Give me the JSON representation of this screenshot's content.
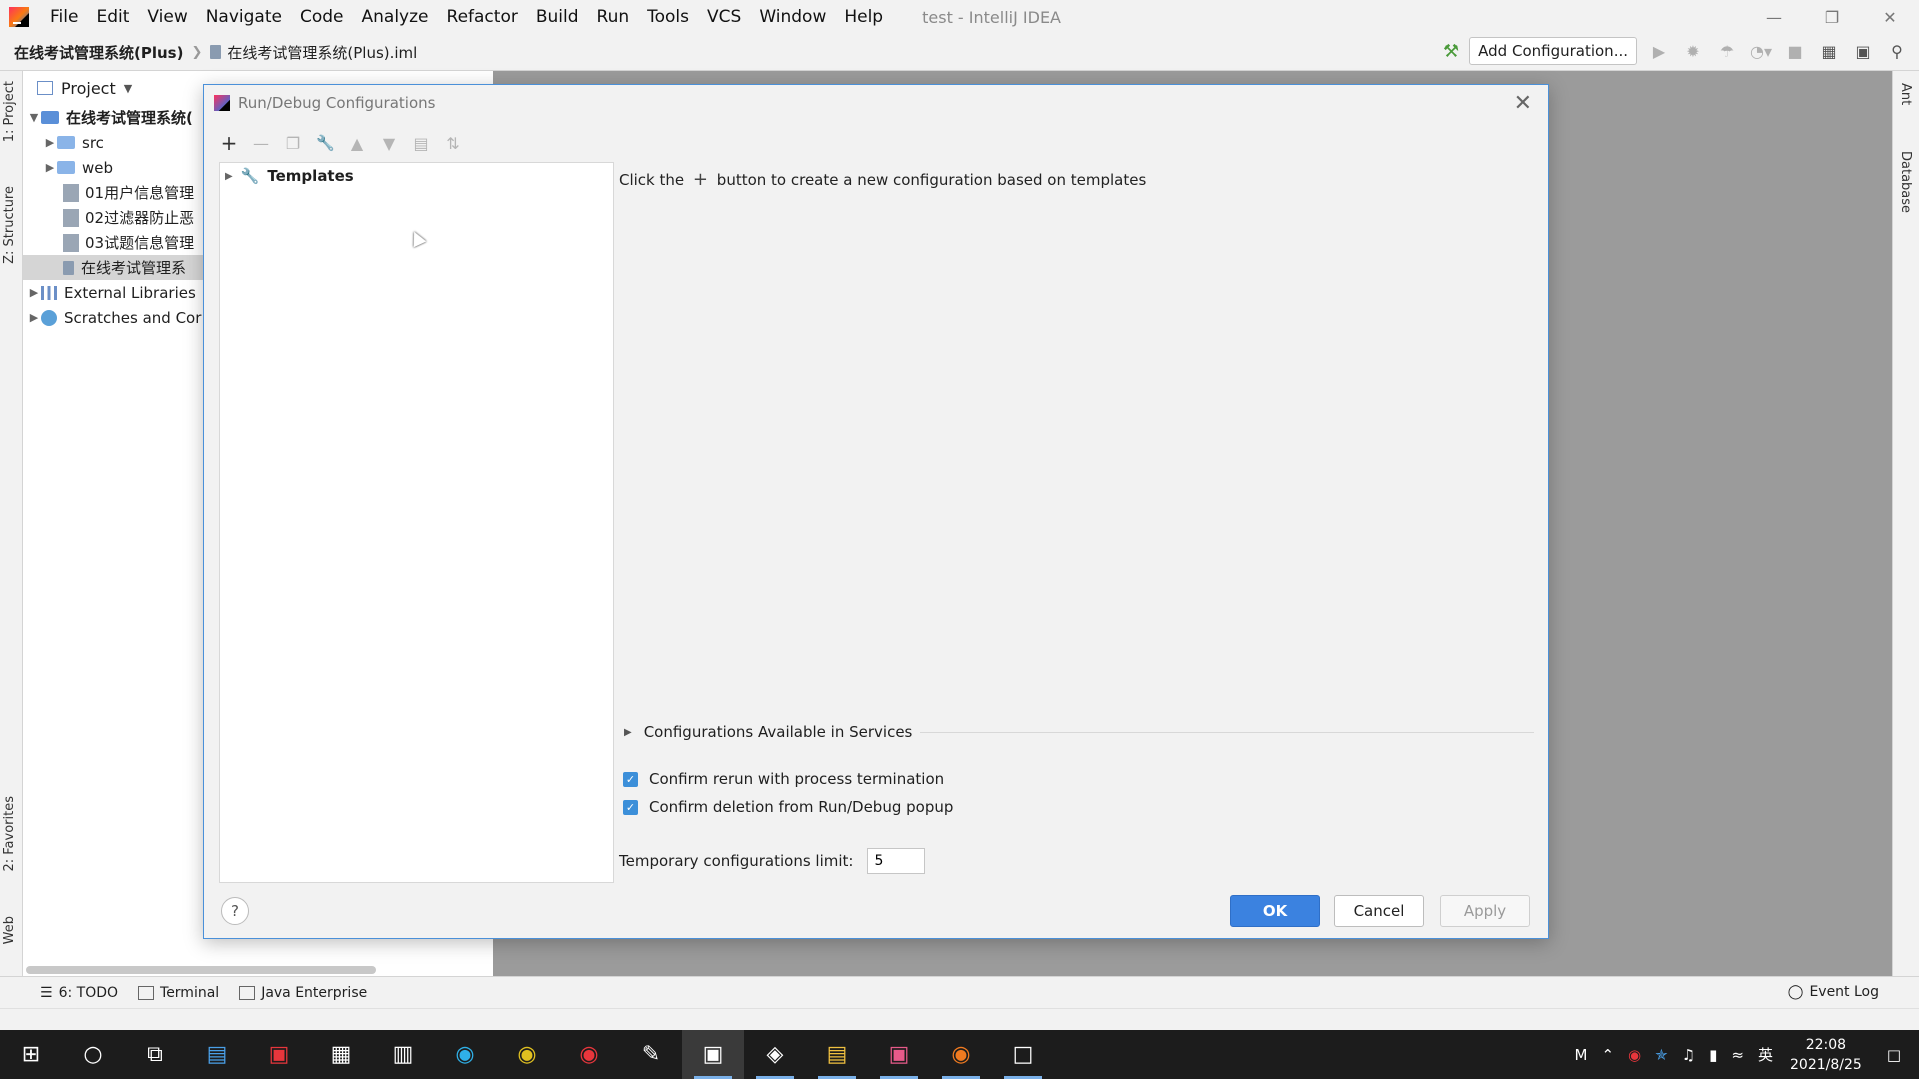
{
  "menubar": {
    "items": [
      "File",
      "Edit",
      "View",
      "Navigate",
      "Code",
      "Analyze",
      "Refactor",
      "Build",
      "Run",
      "Tools",
      "VCS",
      "Window",
      "Help"
    ],
    "window_title": "test - IntelliJ IDEA"
  },
  "navbar": {
    "root": "在线考试管理系统(Plus)",
    "file": "在线考试管理系统(Plus).iml",
    "add_configuration": "Add Configuration..."
  },
  "left_strip": {
    "project_tab": "1: Project",
    "structure_tab": "Z: Structure",
    "favorites_tab": "2: Favorites",
    "web_tab": "Web"
  },
  "right_strip": {
    "ant_tab": "Ant",
    "database_tab": "Database"
  },
  "project": {
    "header": "Project",
    "tree": [
      {
        "label": "在线考试管理系统(",
        "kind": "module"
      },
      {
        "label": "src",
        "kind": "folder"
      },
      {
        "label": "web",
        "kind": "folder"
      },
      {
        "label": "01用户信息管理",
        "kind": "md"
      },
      {
        "label": "02过滤器防止恶",
        "kind": "md"
      },
      {
        "label": "03试题信息管理",
        "kind": "md"
      },
      {
        "label": "在线考试管理系",
        "kind": "iml"
      },
      {
        "label": "External Libraries",
        "kind": "lib"
      },
      {
        "label": "Scratches and Cor",
        "kind": "scratch"
      }
    ]
  },
  "dialog": {
    "title": "Run/Debug Configurations",
    "tree_root": "Templates",
    "hint_pre": "Click the",
    "hint_post": "button to create a new configuration based on templates",
    "services": "Configurations Available in Services",
    "confirm_rerun": "Confirm rerun with process termination",
    "confirm_deletion": "Confirm deletion from Run/Debug popup",
    "temp_limit_label": "Temporary configurations limit:",
    "temp_limit_value": "5",
    "ok": "OK",
    "cancel": "Cancel",
    "apply": "Apply",
    "help": "?"
  },
  "bottom_tools": {
    "todo": "6: TODO",
    "terminal": "Terminal",
    "java_enterprise": "Java Enterprise",
    "event_log": "Event Log"
  },
  "taskbar": {
    "time": "22:08",
    "date": "2021/8/25",
    "ime": "英"
  }
}
